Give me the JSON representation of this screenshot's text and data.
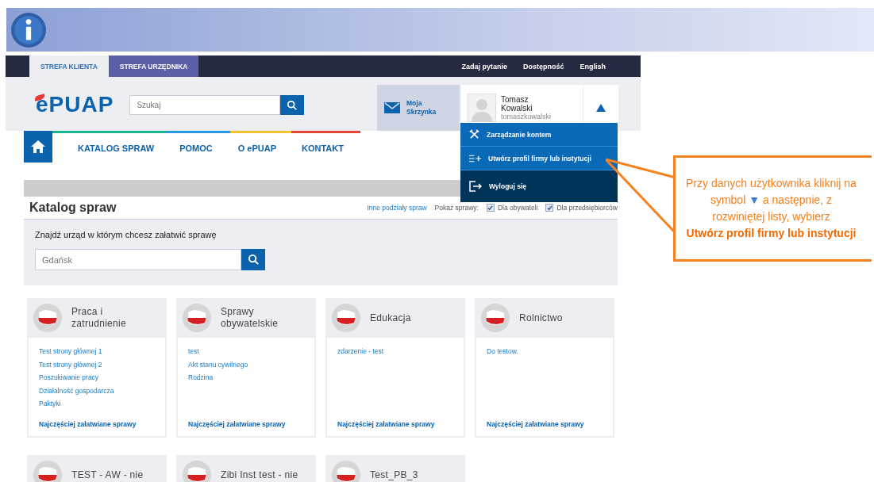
{
  "top_bar": {
    "tabs": [
      {
        "label": "STREFA KLIENTA",
        "selected": true
      },
      {
        "label": "STREFA URZĘDNIKA",
        "selected": false
      }
    ],
    "links": [
      "Zadaj pytanie",
      "Dostępność",
      "English"
    ]
  },
  "header": {
    "logo": "ePUAP",
    "search": {
      "placeholder": "Szukaj"
    },
    "mailbox": "Moja Skrzynka",
    "user": {
      "first_name": "Tomasz",
      "last_name": "Kowalski",
      "login": "tomaszkowalski",
      "expanded": true
    }
  },
  "user_menu": [
    {
      "kind": "manage",
      "label": "Zarządzanie kontem"
    },
    {
      "kind": "add",
      "label": "Utwórz profil firmy lub instytucji"
    },
    {
      "kind": "logout",
      "label": "Wyloguj się"
    }
  ],
  "nav": [
    "KATALOG SPRAW",
    "POMOC",
    "O ePUAP",
    "KONTAKT"
  ],
  "catalog": {
    "title": "Katalog spraw",
    "other_link": "Inne podziały spraw",
    "show_label": "Pokaż sprawy:",
    "filters": [
      {
        "label": "Dla obywateli",
        "checked": true
      },
      {
        "label": "Dla przedsiębiorców",
        "checked": true
      }
    ],
    "office_search": {
      "label": "Znajdź urząd w którym chcesz załatwić sprawę",
      "placeholder": "Gdańsk"
    }
  },
  "cards": [
    {
      "title": [
        "Praca i",
        "zatrudnienie"
      ],
      "links": [
        "Test strony głównej 1",
        "Test strony głównej 2",
        "Poszukiwanie pracy",
        "Działalność gospodarcza",
        "Paktyki"
      ],
      "footer": "Najczęściej załatwiane sprawy"
    },
    {
      "title": [
        "Sprawy",
        "obywatelskie"
      ],
      "links": [
        "test",
        "Akt stanu cywilnego",
        "Rodzina"
      ],
      "footer": "Najczęściej załatwiane sprawy"
    },
    {
      "title": [
        "Edukacja"
      ],
      "links": [
        "zdarzenie - test"
      ],
      "footer": "Najczęściej załatwiane sprawy"
    },
    {
      "title": [
        "Rolnictwo"
      ],
      "links": [
        "Do testow."
      ],
      "footer": "Najczęściej załatwiane sprawy"
    },
    {
      "title": [
        "TEST - AW - nie"
      ]
    },
    {
      "title": [
        "Zibi Inst test - nie"
      ]
    },
    {
      "title": [
        "Test_PB_3"
      ]
    }
  ],
  "callout": {
    "before": "Przy danych użytkownika kliknij na symbol",
    "symbol": "▼",
    "after": "a następnie, z rozwiniętej listy, wybierz",
    "bold": "Utwórz profil firmy lub instytucji"
  }
}
